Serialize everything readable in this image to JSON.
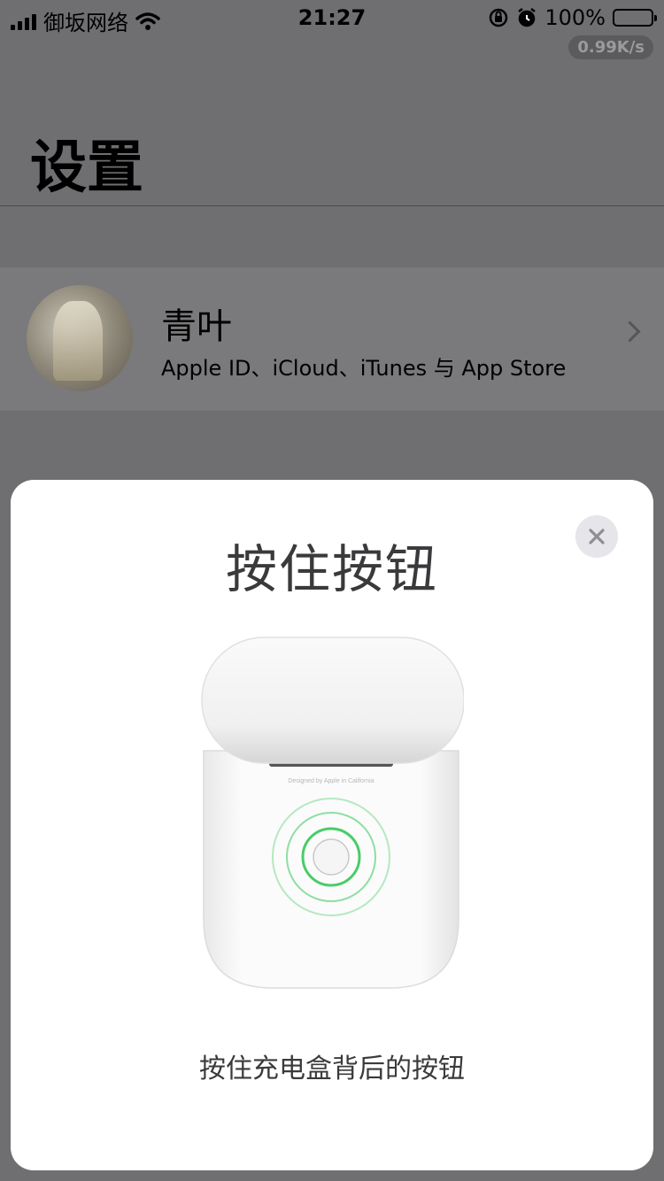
{
  "status_bar": {
    "carrier": "御坂网络",
    "time": "21:27",
    "battery": "100%",
    "net_speed": "0.99K/s",
    "icons": [
      "signal-icon",
      "wifi-icon",
      "orientation-lock-icon",
      "alarm-icon",
      "battery-icon"
    ]
  },
  "settings": {
    "title": "设置",
    "profile": {
      "name": "青叶",
      "subtitle": "Apple ID、iCloud、iTunes 与 App Store"
    }
  },
  "sheet": {
    "title": "按住按钮",
    "case_label": "Designed by Apple in California",
    "caption": "按住充电盒背后的按钮",
    "close_icon": "close-icon"
  },
  "colors": {
    "dim_background": "#6f6f72",
    "sheet_background": "#ffffff",
    "ring_green": "#34c759",
    "close_bg": "#e5e5ea"
  }
}
